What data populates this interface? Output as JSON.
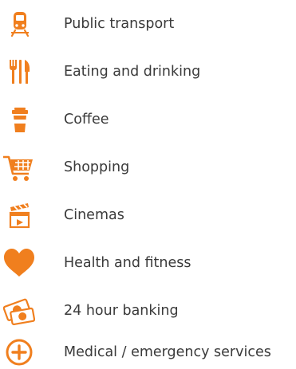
{
  "accent_color": "#f07f1e",
  "legend": {
    "items": [
      {
        "icon": "train-icon",
        "label": "Public transport"
      },
      {
        "icon": "cutlery-icon",
        "label": "Eating and drinking"
      },
      {
        "icon": "coffee-cup-icon",
        "label": "Coffee"
      },
      {
        "icon": "shopping-cart-icon",
        "label": "Shopping"
      },
      {
        "icon": "clapperboard-icon",
        "label": "Cinemas"
      },
      {
        "icon": "heart-icon",
        "label": "Health and fitness"
      },
      {
        "icon": "money-icon",
        "label": "24 hour banking"
      },
      {
        "icon": "medical-plus-icon",
        "label": "Medical / emergency services"
      }
    ]
  }
}
